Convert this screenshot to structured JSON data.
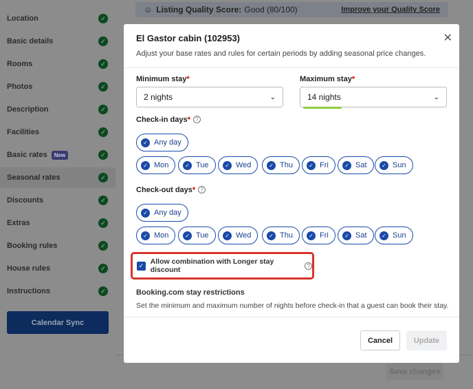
{
  "sidebar": {
    "items": [
      {
        "label": "Location"
      },
      {
        "label": "Basic details"
      },
      {
        "label": "Rooms"
      },
      {
        "label": "Photos"
      },
      {
        "label": "Description"
      },
      {
        "label": "Facilities"
      },
      {
        "label": "Basic rates",
        "badge": "New"
      },
      {
        "label": "Seasonal rates",
        "selected": true
      },
      {
        "label": "Discounts"
      },
      {
        "label": "Extras"
      },
      {
        "label": "Booking rules"
      },
      {
        "label": "House rules"
      },
      {
        "label": "Instructions"
      }
    ],
    "calendar_sync": "Calendar Sync"
  },
  "quality": {
    "icon": "smiley-icon",
    "label": "Listing Quality Score:",
    "value": "Good (80/100)",
    "link": "Improve your Quality Score"
  },
  "save_changes": "Save changes",
  "modal": {
    "title": "El Gastor cabin (102953)",
    "subtitle": "Adjust your base rates and rules for certain periods by adding seasonal price changes.",
    "min_stay": {
      "label": "Minimum stay",
      "value": "2 nights"
    },
    "max_stay": {
      "label": "Maximum stay",
      "value": "14 nights"
    },
    "checkin": {
      "label": "Check-in days",
      "any": "Any day",
      "days": [
        "Mon",
        "Tue",
        "Wed",
        "Thu",
        "Fri",
        "Sat",
        "Sun"
      ]
    },
    "checkout": {
      "label": "Check-out days",
      "any": "Any day",
      "days": [
        "Mon",
        "Tue",
        "Wed",
        "Thu",
        "Fri",
        "Sat",
        "Sun"
      ]
    },
    "combination": {
      "label": "Allow combination with Longer stay discount",
      "checked": true
    },
    "booking_title": "Booking.com stay restrictions",
    "booking_desc": "Set the minimum and maximum number of nights before check-in that a guest can book their stay.",
    "cancel": "Cancel",
    "update": "Update"
  },
  "colors": {
    "accent": "#1a4aa8",
    "highlight": "#d6342c",
    "check": "#0b4a1f"
  }
}
